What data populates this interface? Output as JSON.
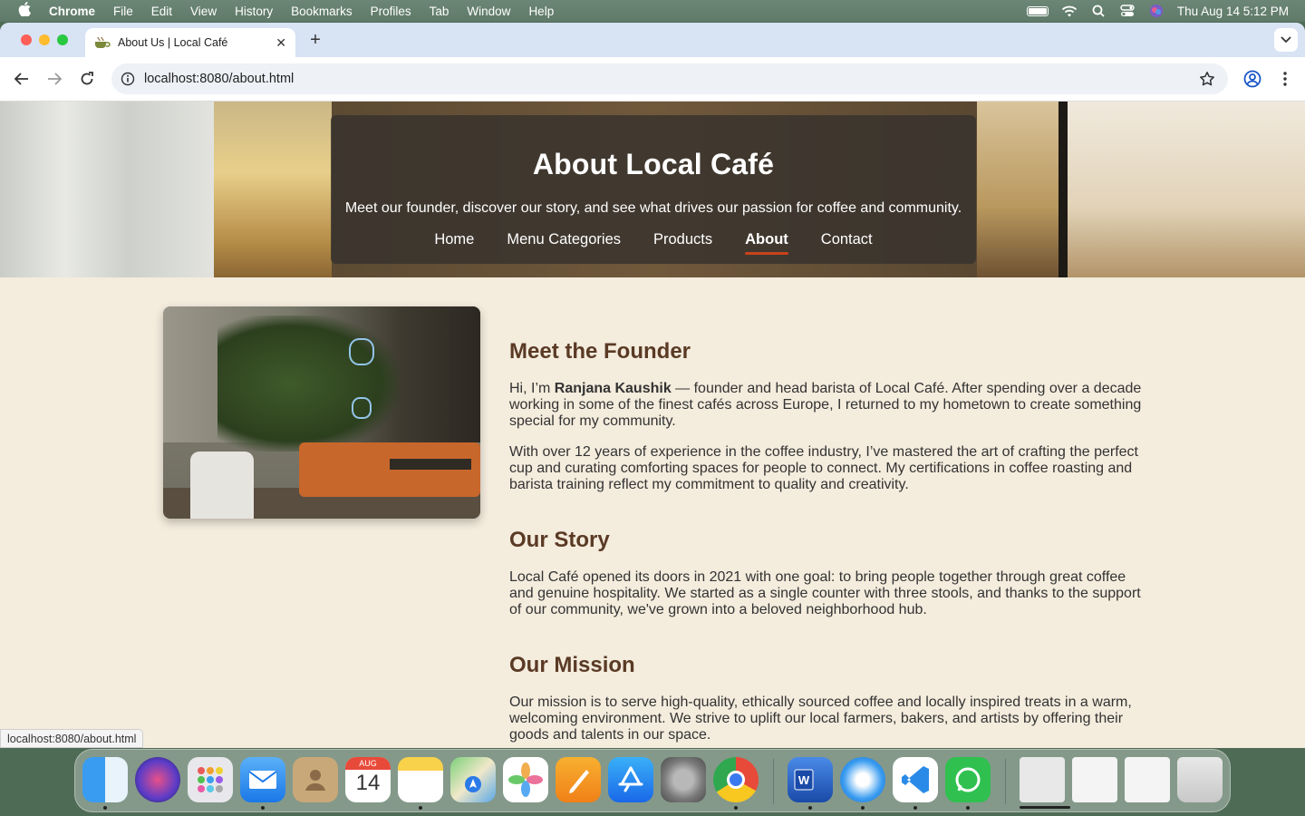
{
  "menubar": {
    "app": "Chrome",
    "items": [
      "File",
      "Edit",
      "View",
      "History",
      "Bookmarks",
      "Profiles",
      "Tab",
      "Window",
      "Help"
    ],
    "clock": "Thu Aug 14  5:12 PM"
  },
  "browser": {
    "tab_title": "About Us | Local Café",
    "url": "localhost:8080/about.html",
    "status_url": "localhost:8080/about.html"
  },
  "hero": {
    "title": "About Local Café",
    "subtitle": "Meet our founder, discover our story, and see what drives our passion for coffee and community.",
    "nav": [
      "Home",
      "Menu Categories",
      "Products",
      "About",
      "Contact"
    ],
    "active_nav": "About"
  },
  "founder": {
    "heading": "Meet the Founder",
    "p1_prefix": "Hi, I’m ",
    "p1_name": "Ranjana Kaushik",
    "p1_rest": " — founder and head barista of Local Café. After spending over a decade working in some of the finest cafés across Europe, I returned to my hometown to create something special for my community.",
    "p2": "With over 12 years of experience in the coffee industry, I’ve mastered the art of crafting the perfect cup and curating comforting spaces for people to connect. My certifications in coffee roasting and barista training reflect my commitment to quality and creativity."
  },
  "story": {
    "heading": "Our Story",
    "p": "Local Café opened its doors in 2021 with one goal: to bring people together through great coffee and genuine hospitality. We started as a single counter with three stools, and thanks to the support of our community, we've grown into a beloved neighborhood hub."
  },
  "mission": {
    "heading": "Our Mission",
    "p": "Our mission is to serve high-quality, ethically sourced coffee and locally inspired treats in a warm, welcoming environment. We strive to uplift our local farmers, bakers, and artists by offering their goods and talents in our space."
  },
  "dock": {
    "calendar_month": "AUG",
    "calendar_day": "14",
    "apps": [
      "finder-icon",
      "siri-icon",
      "launchpad-icon",
      "mail-icon",
      "contacts-icon",
      "calendar-icon",
      "notes-icon",
      "maps-icon",
      "photos-icon",
      "pages-icon",
      "app-store-icon",
      "system-settings-icon",
      "chrome-icon",
      "word-icon",
      "safari-icon",
      "vscode-icon",
      "whatsapp-icon",
      "downloads-stack-icon",
      "document-icon",
      "document-icon-2",
      "trash-icon"
    ]
  },
  "colors": {
    "page_bg": "#f4ecdd",
    "heading_brown": "#5a3a25",
    "nav_underline": "#c8421b"
  }
}
